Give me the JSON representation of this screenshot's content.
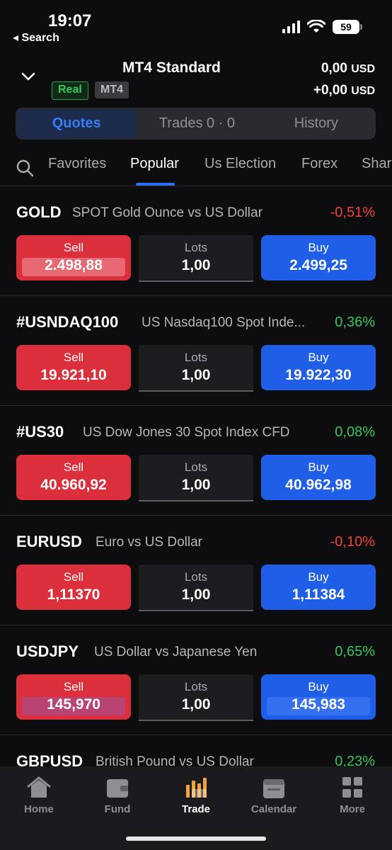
{
  "status_bar": {
    "time": "19:07",
    "back_label": "◂ Search",
    "battery": "59"
  },
  "account": {
    "name": "MT4 Standard",
    "badge_type": "Real",
    "badge_platform": "MT4",
    "balance_main": "0,00",
    "balance_currency": "USD",
    "pl_main": "+0,00",
    "pl_currency": "USD"
  },
  "segments": [
    "Quotes",
    "Trades 0 · 0",
    "History"
  ],
  "categories": [
    "Favorites",
    "Popular",
    "Us Election",
    "Forex",
    "Shares"
  ],
  "trade_labels": {
    "sell": "Sell",
    "lots": "Lots",
    "buy": "Buy"
  },
  "instruments": [
    {
      "symbol": "GOLD",
      "description": "SPOT Gold Ounce vs US Dollar",
      "change": "-0,51%",
      "sell": "2.498,88",
      "lots": "1,00",
      "buy": "2.499,25"
    },
    {
      "symbol": "#USNDAQ100",
      "description": "US Nasdaq100 Spot Inde...",
      "change": "0,36%",
      "sell": "19.921,10",
      "lots": "1,00",
      "buy": "19.922,30"
    },
    {
      "symbol": "#US30",
      "description": "US Dow Jones 30 Spot Index CFD",
      "change": "0,08%",
      "sell": "40.960,92",
      "lots": "1,00",
      "buy": "40.962,98"
    },
    {
      "symbol": "EURUSD",
      "description": "Euro vs US Dollar",
      "change": "-0,10%",
      "sell": "1,11370",
      "lots": "1,00",
      "buy": "1,11384"
    },
    {
      "symbol": "USDJPY",
      "description": "US Dollar vs Japanese Yen",
      "change": "0,65%",
      "sell": "145,970",
      "lots": "1,00",
      "buy": "145,983"
    },
    {
      "symbol": "GBPUSD",
      "description": "British Pound vs US Dollar",
      "change": "0,23%"
    }
  ],
  "tabbar": [
    "Home",
    "Fund",
    "Trade",
    "Calendar",
    "More"
  ],
  "colors": {
    "sell": "#dc2f3c",
    "buy": "#1f5ee6",
    "positive": "#34c759",
    "negative": "#f0443a",
    "accent": "#2d6ff2"
  }
}
